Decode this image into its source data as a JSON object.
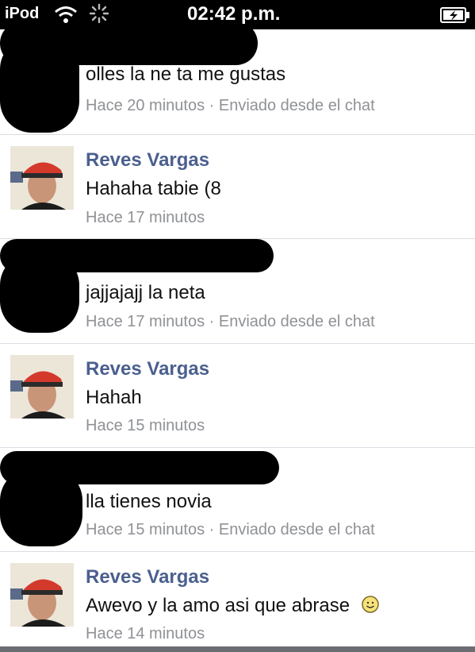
{
  "status_bar": {
    "device": "iPod",
    "time": "02:42 p.m.",
    "icons": [
      "wifi-icon",
      "activity-spinner-icon",
      "battery-charging-icon"
    ]
  },
  "feed": {
    "items": [
      {
        "name": "",
        "message": "olles la ne ta me gustas",
        "meta": "Hace 20 minutos · Enviado desde el chat",
        "redacted": true
      },
      {
        "name": "Reves Vargas",
        "message": "Hahaha tabie (8",
        "meta": "Hace 17 minutos",
        "redacted": false
      },
      {
        "name": "",
        "message": "jajjajajj la neta",
        "meta": "Hace 17 minutos · Enviado desde el chat",
        "redacted": true
      },
      {
        "name": "Reves Vargas",
        "message": "Hahah",
        "meta": "Hace 15 minutos",
        "redacted": false
      },
      {
        "name": "",
        "message": "lla tienes novia",
        "meta": "Hace 15 minutos · Enviado desde el chat",
        "redacted": true
      },
      {
        "name": "Reves Vargas",
        "message": "Awevo y la amo asi que abrase",
        "meta": "Hace 14 minutos",
        "redacted": false,
        "emoji": "smiley-icon"
      }
    ]
  },
  "colors": {
    "name": "#4b5f8f",
    "meta": "#8f9195",
    "divider": "#d9dde3"
  }
}
